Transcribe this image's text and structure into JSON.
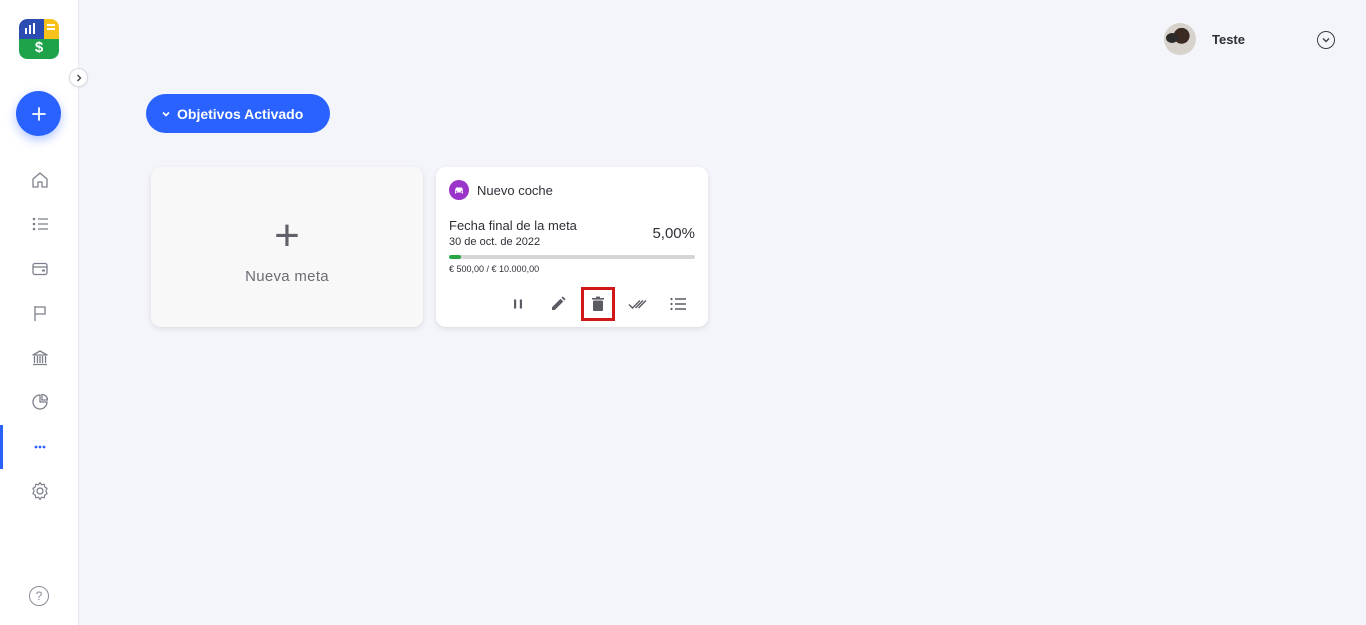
{
  "app": {
    "logo_symbol": "$",
    "collapse_icon": "chevron-right-icon",
    "fab_icon": "plus-icon",
    "help_label": "?"
  },
  "sidebar": {
    "items": [
      {
        "name": "home",
        "icon": "home-icon",
        "active": false
      },
      {
        "name": "transactions",
        "icon": "list-icon",
        "active": false
      },
      {
        "name": "wallets",
        "icon": "wallet-icon",
        "active": false
      },
      {
        "name": "goals",
        "icon": "flag-icon",
        "active": false
      },
      {
        "name": "banks",
        "icon": "bank-icon",
        "active": false
      },
      {
        "name": "reports",
        "icon": "pie-chart-icon",
        "active": false
      },
      {
        "name": "more",
        "icon": "more-icon",
        "active": true
      },
      {
        "name": "settings",
        "icon": "gear-icon",
        "active": false
      }
    ]
  },
  "header": {
    "user_name": "Teste"
  },
  "filter": {
    "label": "Objetivos Activado"
  },
  "new_goal_card": {
    "plus_symbol": "+",
    "label": "Nueva meta"
  },
  "goal": {
    "name": "Nuevo coche",
    "icon": "car-icon",
    "icon_color": "#9b35c9",
    "end_date_label": "Fecha final de la meta",
    "end_date": "30 de oct. de 2022",
    "percent": "5,00%",
    "progress_fraction": 0.05,
    "amount": "€ 500,00 / € 10.000,00",
    "actions": [
      "pause-icon",
      "edit-icon",
      "trash-icon",
      "mark-done-icon",
      "list-icon"
    ],
    "highlighted_action": "trash-icon"
  },
  "colors": {
    "primary": "#2962ff",
    "progress": "#27a844",
    "highlight": "#d01818"
  }
}
